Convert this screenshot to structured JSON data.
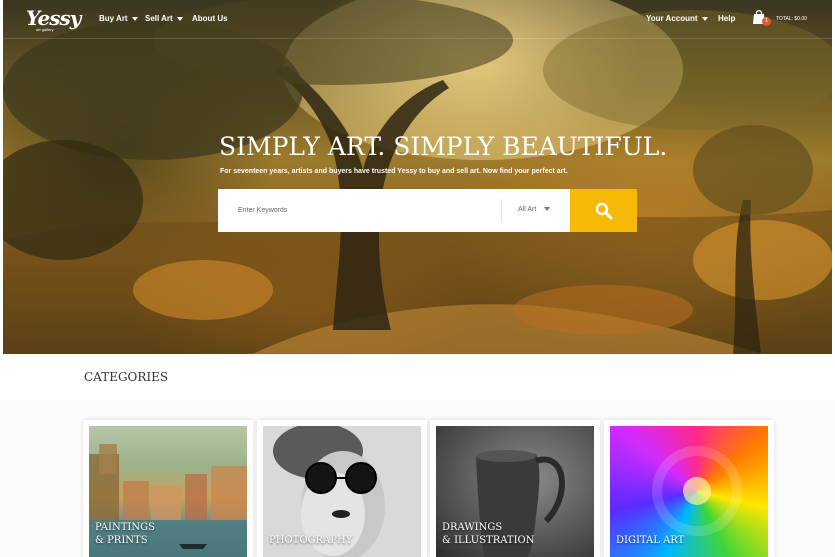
{
  "header": {
    "logo": "Yessy",
    "logo_sub": "art gallery",
    "nav": [
      {
        "label": "Buy Art"
      },
      {
        "label": "Sell Art"
      },
      {
        "label": "About Us"
      }
    ],
    "account_label": "Your Account",
    "help_label": "Help",
    "cart_count": "1",
    "total_label": "TOTAL: $0.00"
  },
  "hero": {
    "headline": "SIMPLY ART. SIMPLY BEAUTIFUL.",
    "tagline": "For seventeen years, artists and buyers have trusted Yessy to buy and sell art. Now find your perfect art.",
    "search": {
      "placeholder": "Enter Keywords",
      "select_value": "All Art",
      "button_icon": "search-icon"
    }
  },
  "categories": {
    "title": "CATEGORIES",
    "items": [
      {
        "line1": "PAINTINGS",
        "line2": "& PRINTS"
      },
      {
        "line1": "PHOTOGRAPHY",
        "line2": ""
      },
      {
        "line1": "DRAWINGS",
        "line2": "& ILLUSTRATION"
      },
      {
        "line1": "DIGITAL ART",
        "line2": ""
      }
    ]
  },
  "colors": {
    "accent": "#f6b905",
    "badge": "#e8542a"
  }
}
